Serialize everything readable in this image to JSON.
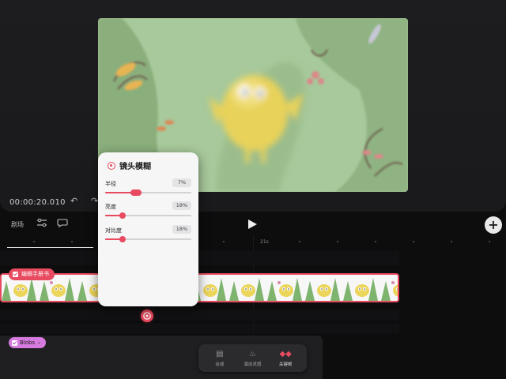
{
  "preview": {
    "timecode": "00:00:20.010"
  },
  "toolbar": {
    "scene_label": "剧场",
    "ruler_mark": "21s"
  },
  "timeline": {
    "clip_tag": "编辑手册书",
    "blobs_tag": "Blobs",
    "frames": [
      1,
      2,
      3,
      4,
      5,
      6,
      7,
      8,
      9,
      10,
      11
    ]
  },
  "dock": {
    "items": [
      {
        "label": "合成",
        "icon": "composite-icon"
      },
      {
        "label": "演出灵感",
        "icon": "flame-icon"
      },
      {
        "label": "关键帧",
        "icon": "keyframe-icon"
      }
    ]
  },
  "panel": {
    "title": "镜头模糊",
    "params": [
      {
        "label": "半径",
        "value": "7%",
        "level": 0.36
      },
      {
        "label": "亮度",
        "value": "18%",
        "level": 0.2
      },
      {
        "label": "对比度",
        "value": "18%",
        "level": 0.2
      }
    ]
  },
  "colors": {
    "accent": "#e84a5f",
    "blobs": "#d77adf",
    "video_bg": "#a6c99a"
  }
}
